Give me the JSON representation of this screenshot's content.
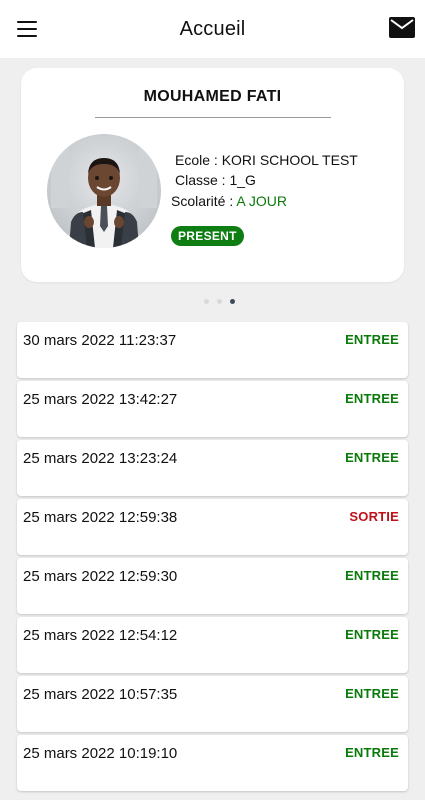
{
  "header": {
    "title": "Accueil",
    "menu_icon": "hamburger-menu-icon",
    "mail_icon": "envelope-icon"
  },
  "student": {
    "name": "MOUHAMED FATI",
    "ecole_label": "Ecole : ",
    "ecole": "KORI SCHOOL TEST",
    "classe_label": "Classe : ",
    "classe": "1_G",
    "scolarite_label": "Scolarité : ",
    "scolarite": "A JOUR",
    "status": "PRESENT"
  },
  "pager": {
    "count": 3,
    "active_index": 2
  },
  "colors": {
    "entree": "#0a7a0a",
    "sortie": "#c0111b",
    "badge": "#0e7d12"
  },
  "events": [
    {
      "datetime": "30 mars 2022 11:23:37",
      "type": "ENTREE"
    },
    {
      "datetime": "25 mars 2022 13:42:27",
      "type": "ENTREE"
    },
    {
      "datetime": "25 mars 2022 13:23:24",
      "type": "ENTREE"
    },
    {
      "datetime": "25 mars 2022 12:59:38",
      "type": "SORTIE"
    },
    {
      "datetime": "25 mars 2022 12:59:30",
      "type": "ENTREE"
    },
    {
      "datetime": "25 mars 2022 12:54:12",
      "type": "ENTREE"
    },
    {
      "datetime": "25 mars 2022 10:57:35",
      "type": "ENTREE"
    },
    {
      "datetime": "25 mars 2022 10:19:10",
      "type": "ENTREE"
    }
  ]
}
